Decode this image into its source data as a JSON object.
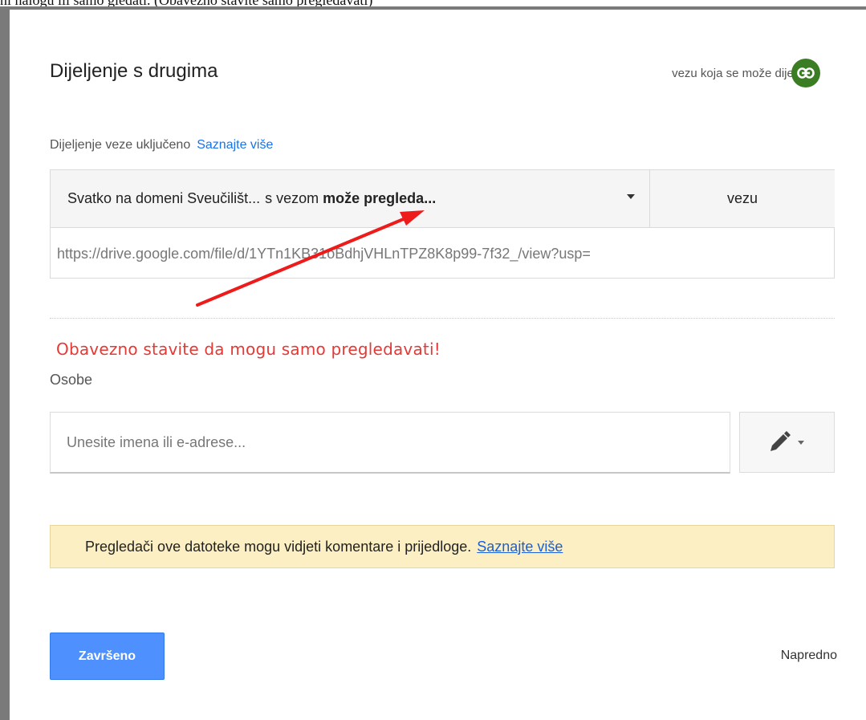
{
  "caption": "ni nalogu ili samo gledati. (Obavezno stavite samo pregledavati)",
  "dialog": {
    "title": "Dijeljenje s drugima",
    "shareable_label": "vezu koja se može dijeliti",
    "link_status": "Dijeljenje veze uključeno",
    "learn_more": "Saznajte više",
    "permission": {
      "part1": "Svatko na domeni Sveučilišt...",
      "part2": "s vezom",
      "part3": "može pregleda...",
      "copy_link_label": "vezu"
    },
    "url": "https://drive.google.com/file/d/1YTn1KB31oBdhjVHLnTPZ8K8p99-7f32_/view?usp=",
    "annotation": "Obavezno stavite da mogu samo pregledavati!",
    "people_label": "Osobe",
    "people_placeholder": "Unesite imena ili e-adrese...",
    "info_text": "Pregledači ove datoteke mogu vidjeti komentare i prijedloge.",
    "info_link": "Saznajte više",
    "done_label": "Završeno",
    "advanced_label": "Napredno"
  },
  "colors": {
    "accent_blue": "#4d90fe",
    "link_blue": "#1a73e8",
    "annotation_red": "#e53935",
    "link_icon_green": "#3b7d23",
    "info_bg": "#fcefc4"
  },
  "icons": {
    "link": "link-icon",
    "caret": "caret-down-icon",
    "pencil": "pencil-icon",
    "arrow": "red-arrow-annotation"
  }
}
